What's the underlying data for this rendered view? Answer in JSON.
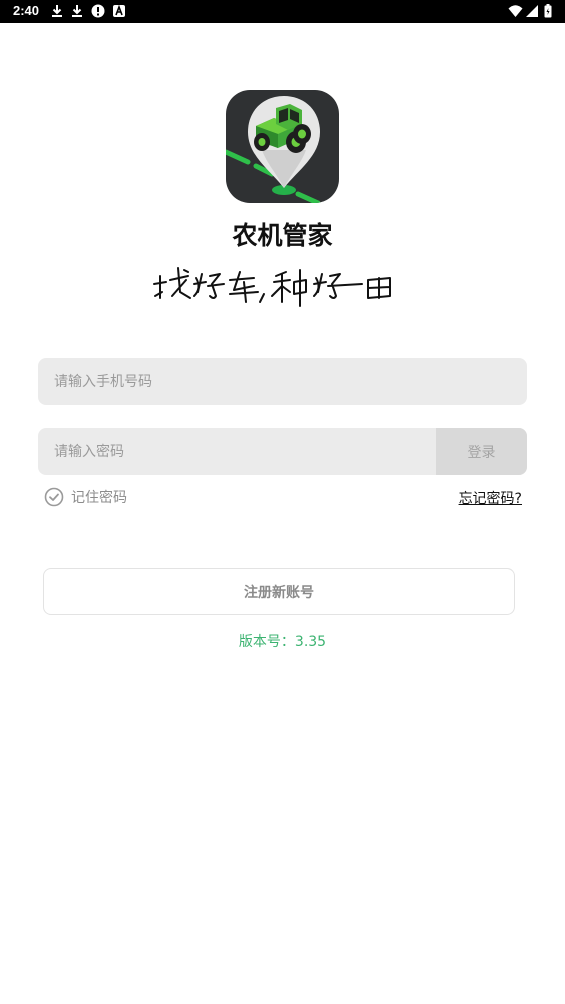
{
  "status_bar": {
    "time": "2:40",
    "left_icons": [
      "download-icon",
      "download-icon",
      "alert-icon",
      "font-icon"
    ],
    "right_icons": [
      "wifi-icon",
      "cell-signal-icon",
      "battery-icon"
    ]
  },
  "app": {
    "name": "农机管家",
    "slogan": "找好车，种好田"
  },
  "login_form": {
    "phone_placeholder": "请输入手机号码",
    "password_placeholder": "请输入密码",
    "login_button": "登录",
    "remember_label": "记住密码",
    "forgot_link": "忘记密码?"
  },
  "register_button": "注册新账号",
  "version_text": "版本号：3.35",
  "colors": {
    "accent_green": "#3cb371",
    "field_bg": "#ebebeb",
    "logo_bg": "#2f3133"
  }
}
